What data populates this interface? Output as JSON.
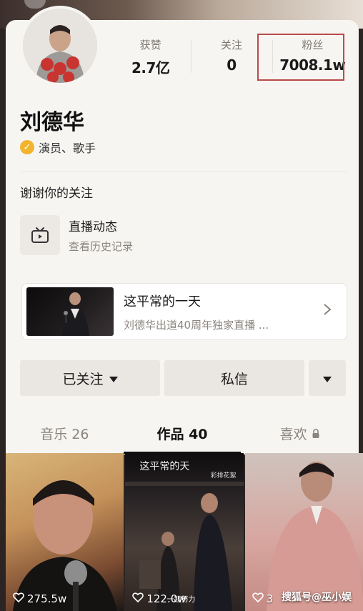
{
  "profile": {
    "name": "刘德华",
    "verified_label": "演员、歌手",
    "bio": "谢谢你的关注"
  },
  "stats": [
    {
      "label": "获赞",
      "value": "2.7亿"
    },
    {
      "label": "关注",
      "value": "0"
    },
    {
      "label": "粉丝",
      "value": "7008.1w"
    }
  ],
  "live": {
    "title": "直播动态",
    "subtitle": "查看历史记录"
  },
  "feature": {
    "title": "这平常的一天",
    "subtitle": "刘德华出道40周年独家直播 ..."
  },
  "actions": {
    "follow_label": "已关注",
    "message_label": "私信"
  },
  "tabs": [
    {
      "label": "音乐 26"
    },
    {
      "label": "作品 40"
    },
    {
      "label": "喜欢"
    }
  ],
  "tiles": [
    {
      "likes": "275.5w"
    },
    {
      "likes": "122.0w",
      "top_text": "这平常的天",
      "tag": "彩排花絮",
      "sub": "一起努力"
    },
    {
      "likes": "3"
    }
  ],
  "watermark": "搜狐号@巫小娱",
  "colors": {
    "highlight_box": "#b94a48",
    "verify_badge": "#f2b42c"
  }
}
